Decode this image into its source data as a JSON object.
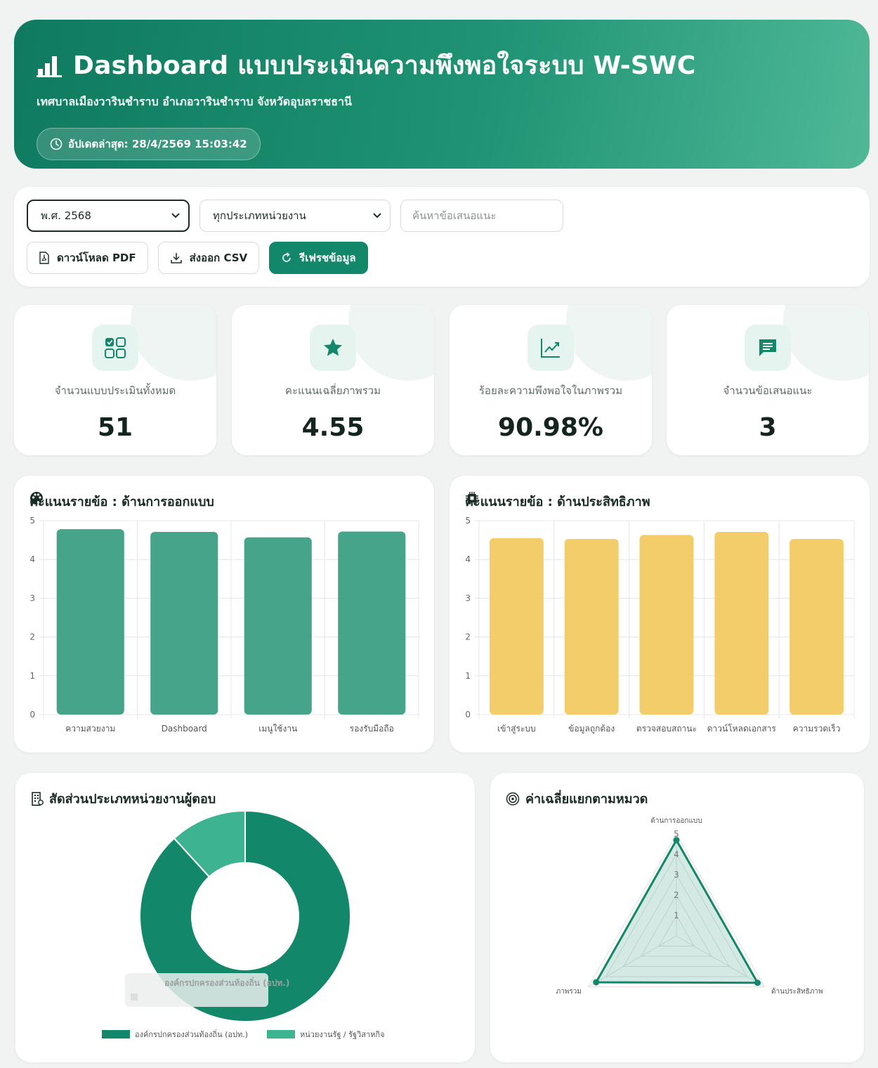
{
  "header": {
    "title": "Dashboard แบบประเมินความพึงพอใจระบบ W-SWC",
    "subtitle": "เทศบาลเมืองวารินชำราบ อำเภอวารินชำราบ จังหวัดอุบลราชธานี",
    "last_update": "อัปเดตล่าสุด: 28/4/2569 15:03:42"
  },
  "filters": {
    "year": "พ.ศ. 2568",
    "org_type": "ทุกประเภทหน่วยงาน",
    "search_placeholder": "ค้นหาข้อเสนอแนะ",
    "search_value": ""
  },
  "actions": {
    "download_pdf": "ดาวน์โหลด PDF",
    "export_csv": "ส่งออก CSV",
    "refresh": "รีเฟรชข้อมูล"
  },
  "stats": [
    {
      "label": "จำนวนแบบประเมินทั้งหมด",
      "value": "51",
      "icon": "grid-check-icon"
    },
    {
      "label": "คะแนนเฉลี่ยภาพรวม",
      "value": "4.55",
      "icon": "star-icon"
    },
    {
      "label": "ร้อยละความพึงพอใจในภาพรวม",
      "value": "90.98%",
      "icon": "trend-chart-icon"
    },
    {
      "label": "จำนวนข้อเสนอแนะ",
      "value": "3",
      "icon": "comment-icon"
    }
  ],
  "colors": {
    "primary": "#12876a",
    "bar_green": "#45a48a",
    "bar_yellow": "#f3cd6a",
    "donut_dark": "#12876a",
    "donut_light": "#3db391"
  },
  "chart_data": [
    {
      "type": "bar",
      "title": "คะแนนรายข้อ : ด้านการออกแบบ",
      "categories": [
        "ความสวยงาม",
        "Dashboard",
        "เมนูใช้งาน",
        "รองรับมือถือ"
      ],
      "values": [
        4.78,
        4.71,
        4.57,
        4.72
      ],
      "ylim": [
        0,
        5
      ],
      "yticks": [
        "0",
        "1",
        "2",
        "3",
        "4",
        "5"
      ],
      "grid": true
    },
    {
      "type": "bar",
      "title": "คะแนนรายข้อ : ด้านประสิทธิภาพ",
      "categories": [
        "เข้าสู่ระบบ",
        "ข้อมูลถูกต้อง",
        "ตรวจสอบสถานะ",
        "ดาวน์โหลดเอกสาร",
        "ความรวดเร็ว"
      ],
      "values": [
        4.55,
        4.53,
        4.63,
        4.71,
        4.53
      ],
      "ylim": [
        0,
        5
      ],
      "yticks": [
        "0",
        "1",
        "2",
        "3",
        "4",
        "5"
      ],
      "grid": true
    },
    {
      "type": "pie",
      "title": "สัดส่วนประเภทหน่วยงานผู้ตอบ",
      "series": [
        {
          "name": "องค์กรปกครองส่วนท้องถิ่น (อปท.)",
          "value": 45
        },
        {
          "name": "หน่วยงานรัฐ / รัฐวิสาหกิจ",
          "value": 6
        }
      ],
      "legend": "bottom",
      "tooltip": "องค์กรปกครองส่วนท้องถิ่น (อปท.)"
    },
    {
      "type": "radar",
      "title": "ค่าเฉลี่ยแยกตามหมวด",
      "categories": [
        "ด้านการออกแบบ",
        "ด้านประสิทธิภาพ",
        "ภาพรวม"
      ],
      "values": [
        4.7,
        4.6,
        4.55
      ],
      "rlim": [
        0,
        5
      ],
      "rticks": [
        "1",
        "2",
        "3",
        "4",
        "5"
      ]
    }
  ]
}
